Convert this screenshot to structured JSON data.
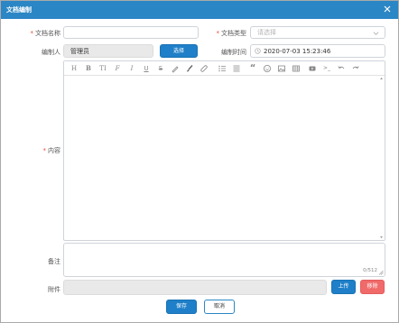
{
  "dialog": {
    "title": "文档编制"
  },
  "form": {
    "doc_name_label": "文档名称",
    "doc_type_label": "文档类型",
    "doc_type_placeholder": "请选择",
    "author_label": "编制人",
    "author_value": "管理员",
    "select_button": "选择",
    "time_label": "编制时间",
    "time_value": "2020-07-03 15:23:46",
    "content_label": "内容",
    "remark_label": "备注",
    "remark_counter": "0/512",
    "attach_label": "附件",
    "upload_button": "上传",
    "remove_button": "移除",
    "save_button": "保存",
    "cancel_button": "取消"
  },
  "toolbar": {
    "heading_glyph": "H",
    "bold_glyph": "B",
    "fontsize_glyph": "TI",
    "font_glyph": "F",
    "italic_glyph": "I",
    "underline_glyph": "U",
    "strike_glyph": "S",
    "quote_glyph": "“",
    "code_glyph": ">_"
  },
  "colors": {
    "accent": "#2b86c5",
    "danger": "#f06a6a",
    "required": "#e74c3c"
  }
}
